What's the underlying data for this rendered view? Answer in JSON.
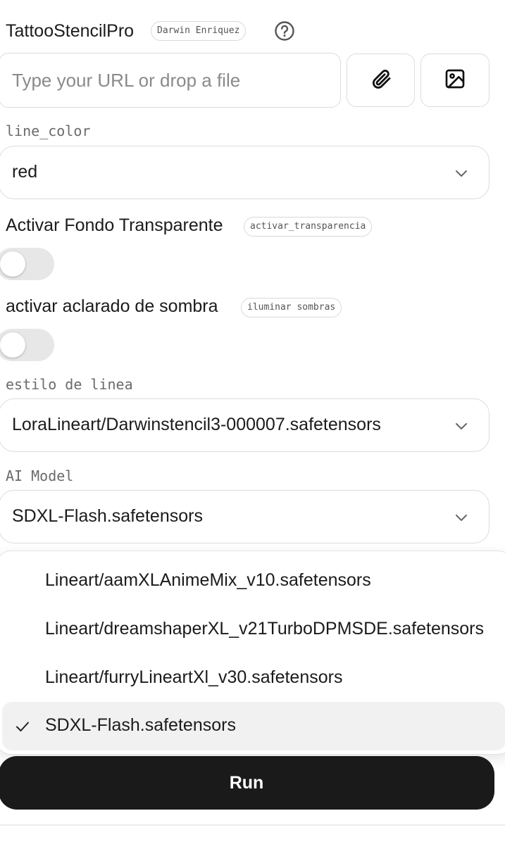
{
  "header": {
    "title": "TattooStencilPro",
    "author": "Darwin Enriquez",
    "help_icon": "question-circle-icon"
  },
  "url_input": {
    "placeholder": "Type your URL or drop a file",
    "value": "",
    "attach_icon": "paperclip-icon",
    "image_icon": "image-icon"
  },
  "line_color": {
    "label": "line_color",
    "value": "red"
  },
  "transparency": {
    "label": "Activar Fondo Transparente",
    "param": "activar_transparencia",
    "enabled": false
  },
  "shadow": {
    "label": "activar aclarado de sombra",
    "param": "iluminar sombras",
    "enabled": false
  },
  "line_style": {
    "label": "estilo de linea",
    "value": "LoraLineart/Darwinstencil3-000007.safetensors"
  },
  "ai_model": {
    "label": "AI Model",
    "value": "SDXL-Flash.safetensors",
    "options": [
      {
        "label": "Lineart/aamXLAnimeMix_v10.safetensors",
        "selected": false
      },
      {
        "label": "Lineart/dreamshaperXL_v21TurboDPMSDE.safetensors",
        "selected": false
      },
      {
        "label": "Lineart/furryLineartXl_v30.safetensors",
        "selected": false
      },
      {
        "label": "SDXL-Flash.safetensors",
        "selected": true
      }
    ]
  },
  "run_button": {
    "label": "Run"
  },
  "colors": {
    "run_bg": "#1a1a1a",
    "toggle_off": "#e7e7e7",
    "selected_option_bg": "#f1f1f1"
  }
}
